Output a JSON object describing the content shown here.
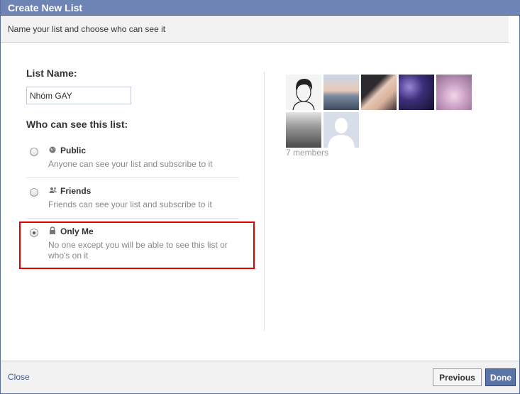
{
  "dialog": {
    "title": "Create New List",
    "subtitle": "Name your list and choose who can see it"
  },
  "form": {
    "list_name_label": "List Name:",
    "list_name_value": "Nhóm GAY",
    "visibility_label": "Who can see this list:",
    "options": [
      {
        "icon": "globe-icon",
        "title": "Public",
        "description": "Anyone can see your list and subscribe to it",
        "selected": false
      },
      {
        "icon": "friends-icon",
        "title": "Friends",
        "description": "Friends can see your list and subscribe to it",
        "selected": false
      },
      {
        "icon": "lock-icon",
        "title": "Only Me",
        "description": "No one except you will be able to see this list or who's on it",
        "selected": true
      }
    ]
  },
  "members": {
    "count_text": "7 members"
  },
  "footer": {
    "close_label": "Close",
    "previous_label": "Previous",
    "done_label": "Done"
  },
  "colors": {
    "titlebar": "#6d84b4",
    "link": "#3b5998",
    "highlight": "#e00000",
    "done_button": "#5b74a8"
  }
}
